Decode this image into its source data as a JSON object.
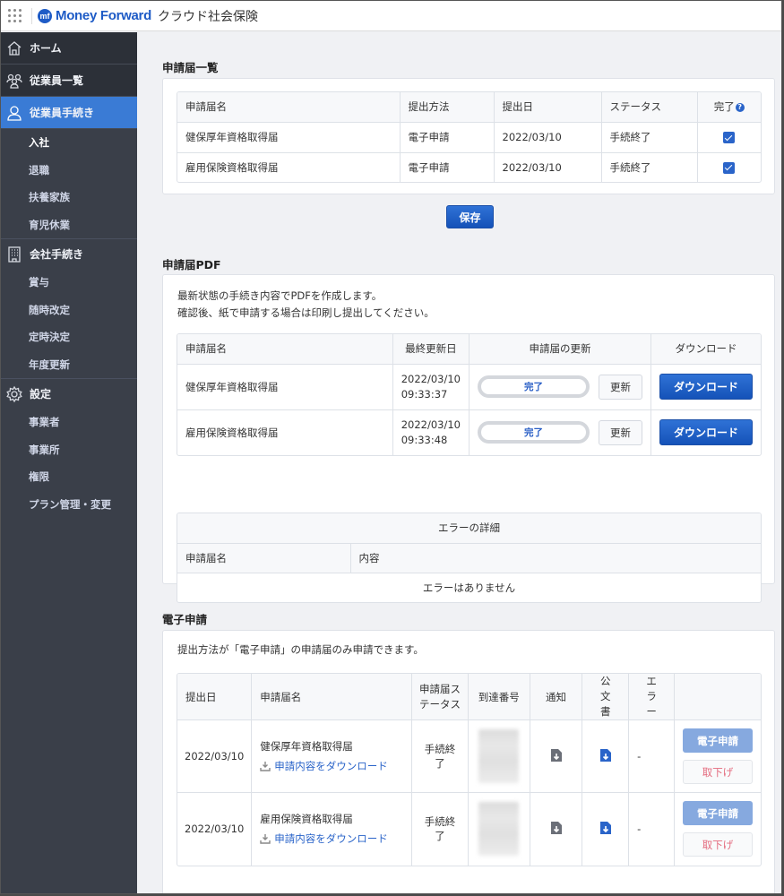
{
  "header": {
    "brand": "Money Forward",
    "product": "クラウド社会保険",
    "apps_icon": "grid-apps-icon"
  },
  "sidebar": {
    "home": {
      "label": "ホーム",
      "icon": "home-icon"
    },
    "employees": {
      "label": "従業員一覧",
      "icon": "people-icon"
    },
    "employee_procedures": {
      "label": "従業員手続き",
      "icon": "person-icon",
      "active": true,
      "items": [
        {
          "label": "入社",
          "current": true
        },
        {
          "label": "退職"
        },
        {
          "label": "扶養家族"
        },
        {
          "label": "育児休業"
        }
      ]
    },
    "company_procedures": {
      "label": "会社手続き",
      "icon": "building-icon",
      "items": [
        {
          "label": "賞与"
        },
        {
          "label": "随時改定"
        },
        {
          "label": "定時決定"
        },
        {
          "label": "年度更新"
        }
      ]
    },
    "settings": {
      "label": "設定",
      "icon": "gear-icon",
      "items": [
        {
          "label": "事業者"
        },
        {
          "label": "事業所"
        },
        {
          "label": "権限"
        },
        {
          "label": "プラン管理・変更"
        }
      ]
    }
  },
  "applications_list": {
    "title": "申請届一覧",
    "columns": [
      "申請届名",
      "提出方法",
      "提出日",
      "ステータス",
      "完了"
    ],
    "help_icon": "?",
    "rows": [
      {
        "name": "健保厚年資格取得届",
        "method": "電子申請",
        "date": "2022/03/10",
        "status": "手続終了",
        "completed": true
      },
      {
        "name": "雇用保険資格取得届",
        "method": "電子申請",
        "date": "2022/03/10",
        "status": "手続終了",
        "completed": true
      }
    ],
    "save_label": "保存"
  },
  "pdf_section": {
    "title": "申請届PDF",
    "description": [
      "最新状態の手続き内容でPDFを作成します。",
      "確認後、紙で申請する場合は印刷し提出してください。"
    ],
    "columns": [
      "申請届名",
      "最終更新日",
      "申請届の更新",
      "ダウンロード"
    ],
    "rows": [
      {
        "name": "健保厚年資格取得届",
        "updated_date": "2022/03/10",
        "updated_time": "09:33:37",
        "progress_label": "完了",
        "progress": 100,
        "update_label": "更新",
        "download_label": "ダウンロード"
      },
      {
        "name": "雇用保険資格取得届",
        "updated_date": "2022/03/10",
        "updated_time": "09:33:48",
        "progress_label": "完了",
        "progress": 100,
        "update_label": "更新",
        "download_label": "ダウンロード"
      }
    ],
    "errors": {
      "title": "エラーの詳細",
      "columns": [
        "申請届名",
        "内容"
      ],
      "empty": "エラーはありません"
    }
  },
  "efiling_section": {
    "title": "電子申請",
    "description": "提出方法が「電子申請」の申請届のみ申請できます。",
    "columns": [
      "提出日",
      "申請届名",
      "申請届ステータス",
      "到達番号",
      "通知",
      "公文書",
      "エラー",
      ""
    ],
    "rows": [
      {
        "date": "2022/03/10",
        "name": "健保厚年資格取得届",
        "download_link": "申請内容をダウンロード",
        "status": "手続終了",
        "arrival_number": "[redacted]",
        "error": "-",
        "efile_label": "電子申請",
        "withdraw_label": "取下げ"
      },
      {
        "date": "2022/03/10",
        "name": "雇用保険資格取得届",
        "download_link": "申請内容をダウンロード",
        "status": "手続終了",
        "arrival_number": "[redacted]",
        "error": "-",
        "efile_label": "電子申請",
        "withdraw_label": "取下げ"
      }
    ]
  },
  "colors": {
    "brand": "#1e5bc6",
    "sidebar_bg": "#3a3f49",
    "sidebar_active": "#3a7bd5",
    "primary_button": "#1e5fc6",
    "withdraw_text": "#e46a7d"
  }
}
